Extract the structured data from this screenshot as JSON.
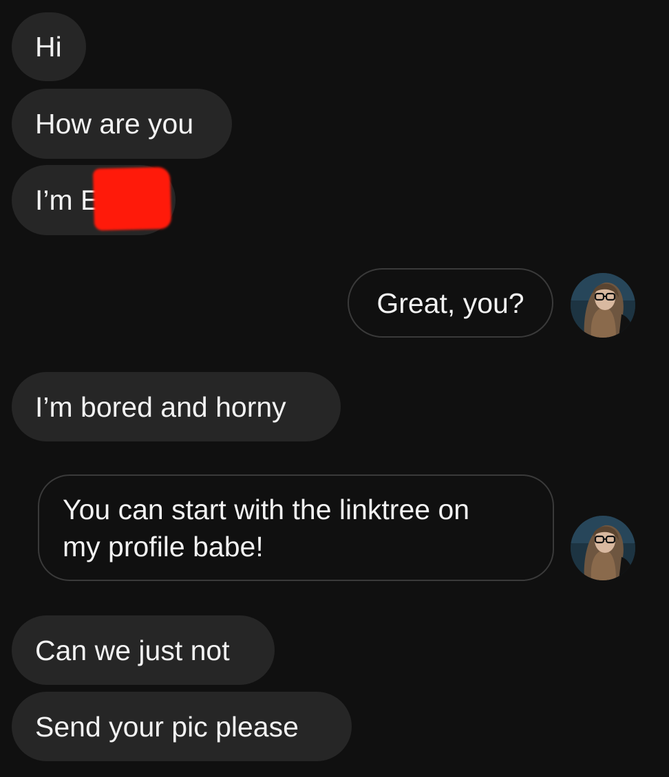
{
  "messages": [
    {
      "from": "other",
      "text": "Hi"
    },
    {
      "from": "other",
      "text": "How are you"
    },
    {
      "from": "other",
      "text": "I’m E"
    },
    {
      "from": "me",
      "text": "Great, you?"
    },
    {
      "from": "other",
      "text": "I’m bored and horny"
    },
    {
      "from": "me",
      "text_line1": "You can start with the linktree on",
      "text_line2": "my profile babe!"
    },
    {
      "from": "other",
      "text": "Can we just not"
    },
    {
      "from": "other",
      "text": "Send your pic please"
    }
  ],
  "colors": {
    "background": "#101010",
    "incoming_bubble": "#262626",
    "outgoing_border": "#3a3a3a",
    "text": "#f2f2f2",
    "redaction": "#ff1a0a"
  },
  "icons": {
    "avatar": "profile-photo-avatar-icon"
  }
}
